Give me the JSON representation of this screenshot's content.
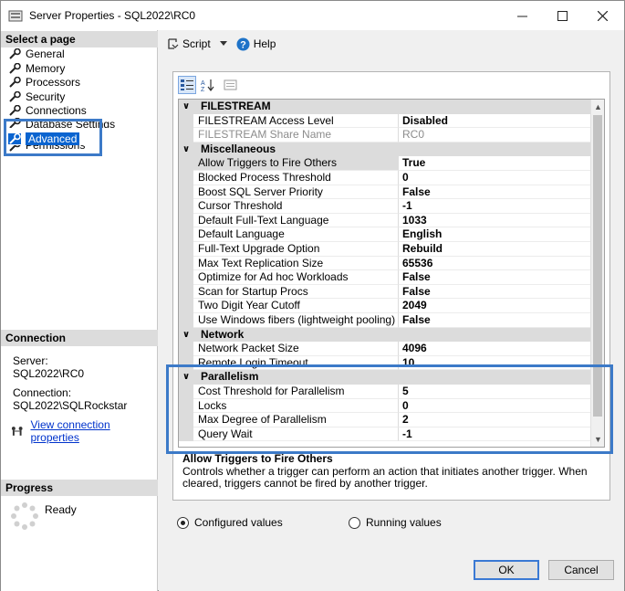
{
  "window": {
    "title": "Server Properties - SQL2022\\RC0"
  },
  "left": {
    "select_page_header": "Select a page",
    "pages": [
      {
        "label": "General"
      },
      {
        "label": "Memory"
      },
      {
        "label": "Processors"
      },
      {
        "label": "Security"
      },
      {
        "label": "Connections"
      },
      {
        "label": "Database Settings"
      },
      {
        "label": "Advanced"
      },
      {
        "label": "Permissions"
      }
    ],
    "connection_header": "Connection",
    "server_label": "Server:",
    "server_value": "SQL2022\\RC0",
    "connection_label": "Connection:",
    "connection_value": "SQL2022\\SQLRockstar",
    "view_link": "View connection properties",
    "progress_header": "Progress",
    "progress_status": "Ready"
  },
  "toolbar": {
    "script_label": "Script",
    "help_label": "Help"
  },
  "grid": {
    "rows": [
      {
        "type": "category",
        "name": "FILESTREAM"
      },
      {
        "type": "prop",
        "name": "FILESTREAM Access Level",
        "value": "Disabled"
      },
      {
        "type": "prop",
        "name": "FILESTREAM Share Name",
        "value": "RC0",
        "disabled": true
      },
      {
        "type": "category",
        "name": "Miscellaneous"
      },
      {
        "type": "prop",
        "name": "Allow Triggers to Fire Others",
        "value": "True",
        "selected": true
      },
      {
        "type": "prop",
        "name": "Blocked Process Threshold",
        "value": "0"
      },
      {
        "type": "prop",
        "name": "Boost SQL Server Priority",
        "value": "False"
      },
      {
        "type": "prop",
        "name": "Cursor Threshold",
        "value": "-1"
      },
      {
        "type": "prop",
        "name": "Default Full-Text Language",
        "value": "1033"
      },
      {
        "type": "prop",
        "name": "Default Language",
        "value": "English"
      },
      {
        "type": "prop",
        "name": "Full-Text Upgrade Option",
        "value": "Rebuild"
      },
      {
        "type": "prop",
        "name": "Max Text Replication Size",
        "value": "65536"
      },
      {
        "type": "prop",
        "name": "Optimize for Ad hoc Workloads",
        "value": "False"
      },
      {
        "type": "prop",
        "name": "Scan for Startup Procs",
        "value": "False"
      },
      {
        "type": "prop",
        "name": "Two Digit Year Cutoff",
        "value": "2049"
      },
      {
        "type": "prop",
        "name": "Use Windows fibers (lightweight pooling)",
        "value": "False"
      },
      {
        "type": "category",
        "name": "Network"
      },
      {
        "type": "prop",
        "name": "Network Packet Size",
        "value": "4096"
      },
      {
        "type": "prop",
        "name": "Remote Login Timeout",
        "value": "10"
      },
      {
        "type": "category",
        "name": "Parallelism"
      },
      {
        "type": "prop",
        "name": "Cost Threshold for Parallelism",
        "value": "5"
      },
      {
        "type": "prop",
        "name": "Locks",
        "value": "0"
      },
      {
        "type": "prop",
        "name": "Max Degree of Parallelism",
        "value": "2"
      },
      {
        "type": "prop",
        "name": "Query Wait",
        "value": "-1"
      }
    ],
    "description_title": "Allow Triggers to Fire Others",
    "description_text": "Controls whether a trigger can perform an action that initiates another trigger. When cleared, triggers cannot be fired by another trigger."
  },
  "options": {
    "configured_label": "Configured values",
    "running_label": "Running values",
    "selected": "configured"
  },
  "buttons": {
    "ok": "OK",
    "cancel": "Cancel"
  },
  "colors": {
    "highlight_box": "#3c7ac8",
    "selection": "#0a64d0"
  }
}
